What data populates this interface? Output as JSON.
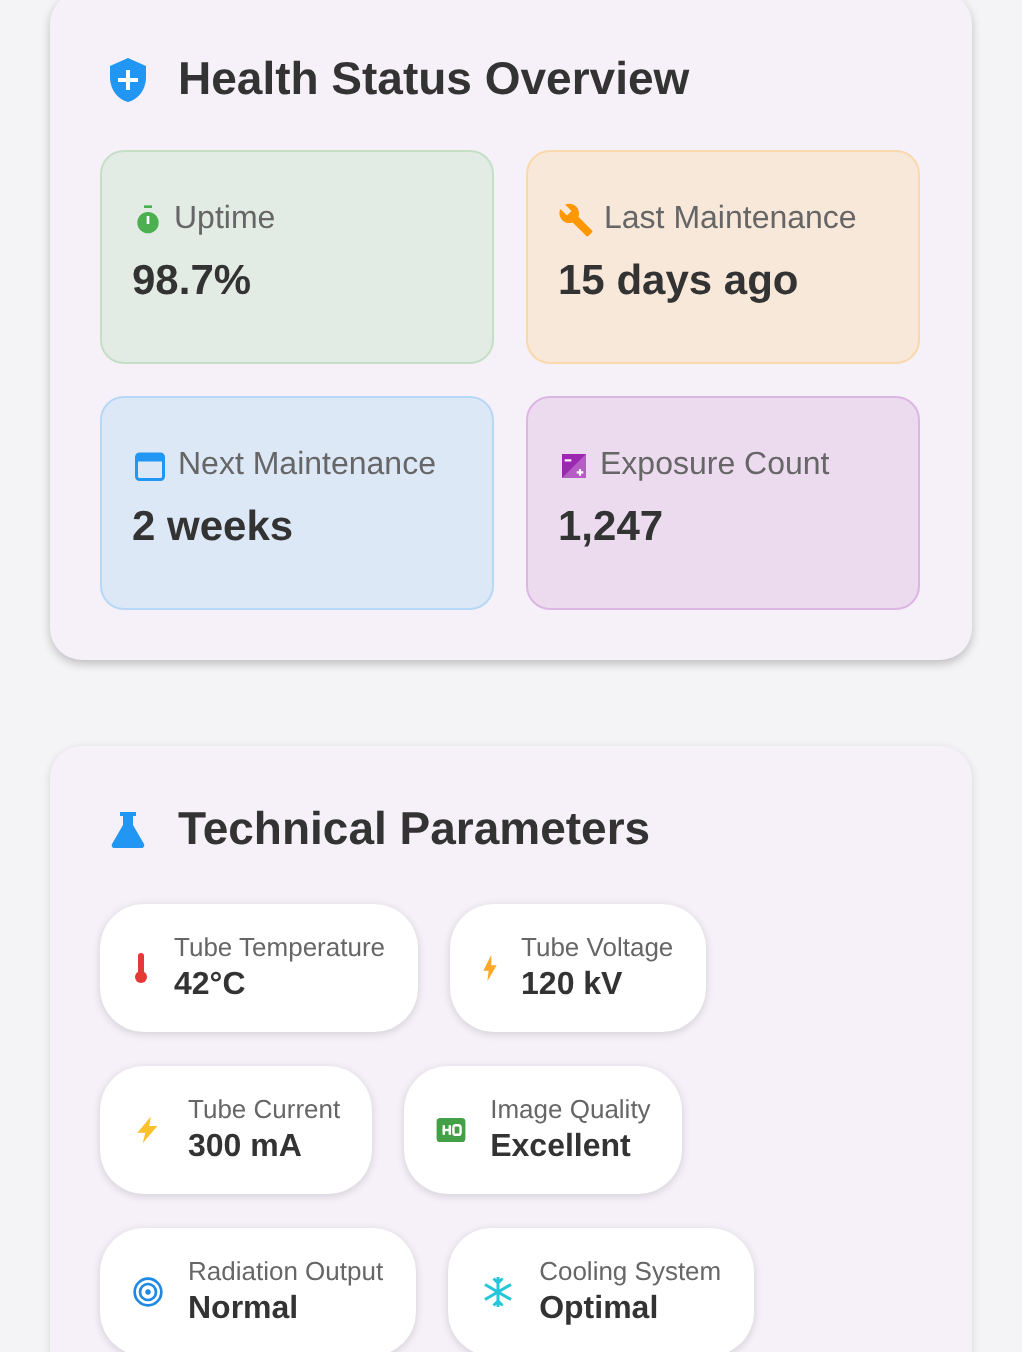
{
  "health": {
    "title": "Health Status Overview",
    "tiles": [
      {
        "kind": "timer",
        "label": "Uptime",
        "value": "98.7%",
        "color": "#4caf50"
      },
      {
        "kind": "wrench",
        "label": "Last Maintenance",
        "value": "15 days ago",
        "color": "#ff9800"
      },
      {
        "kind": "calendar",
        "label": "Next Maintenance",
        "value": "2 weeks",
        "color": "#2196f3"
      },
      {
        "kind": "exposure",
        "label": "Exposure Count",
        "value": "1,247",
        "color": "#9c27b0"
      }
    ]
  },
  "technical": {
    "title": "Technical Parameters",
    "rows": [
      [
        {
          "kind": "thermometer",
          "label": "Tube Temperature",
          "value": "42°C"
        },
        {
          "kind": "bolt-small",
          "label": "Tube Voltage",
          "value": "120 kV"
        }
      ],
      [
        {
          "kind": "bolt",
          "label": "Tube Current",
          "value": "300 mA"
        },
        {
          "kind": "hq",
          "label": "Image Quality",
          "value": "Excellent"
        }
      ],
      [
        {
          "kind": "radiation",
          "label": "Radiation Output",
          "value": "Normal"
        },
        {
          "kind": "snowflake",
          "label": "Cooling System",
          "value": "Optimal"
        }
      ]
    ]
  }
}
